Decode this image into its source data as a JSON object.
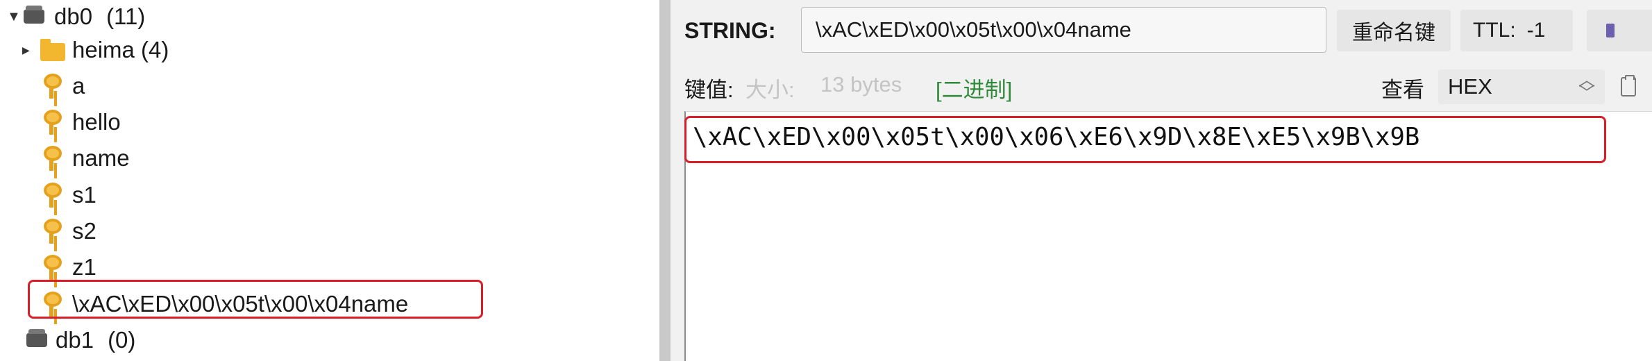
{
  "tree": {
    "db0": {
      "label": "db0",
      "count": "(11)"
    },
    "folder": {
      "label": "heima (4)"
    },
    "keys": [
      "a",
      "hello",
      "name",
      "s1",
      "s2",
      "z1",
      "\\xAC\\xED\\x00\\x05t\\x00\\x04name"
    ],
    "db1": {
      "label": "db1",
      "count": "(0)"
    }
  },
  "panel": {
    "type_label": "STRING:",
    "key_name": "\\xAC\\xED\\x00\\x05t\\x00\\x04name",
    "rename_button": "重命名键",
    "ttl_label": "TTL:",
    "ttl_value": "-1",
    "value_label": "键值:",
    "size_label": "大小:",
    "size_value": "13 bytes",
    "binary_tag": "[二进制]",
    "view_label": "查看",
    "view_mode": "HEX",
    "value_hex": "\\xAC\\xED\\x00\\x05t\\x00\\x06\\xE6\\x9D\\x8E\\xE5\\x9B\\x9B"
  },
  "colors": {
    "highlight_box": "#d61f29",
    "key_icon": "#e5a11c",
    "folder_icon": "#f3b72f",
    "binary_tag": "#2f8a3a",
    "size_faded": "#c4c4c4"
  }
}
